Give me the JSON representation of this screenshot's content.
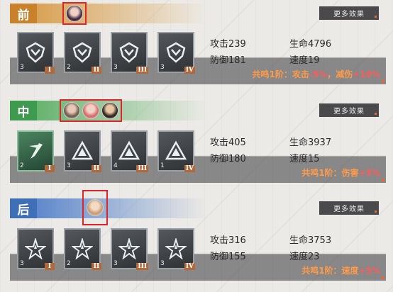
{
  "colors": {
    "front": "#c9822a",
    "middle": "#3e9a4e",
    "back": "#3f6fb6",
    "highlight_box": "#e0252a",
    "resonance_text": "#ff9a4a"
  },
  "rows": [
    {
      "badge": "前",
      "more_label": "更多效果",
      "cards": [
        {
          "level": "3",
          "tier": "I",
          "icon": "shield-emblem-icon"
        },
        {
          "level": "2",
          "tier": "II",
          "icon": "shield-emblem-icon"
        },
        {
          "level": "3",
          "tier": "III",
          "icon": "shield-emblem-icon"
        },
        {
          "level": "3",
          "tier": "IV",
          "icon": "shield-emblem-icon"
        }
      ],
      "stats": {
        "atk": "攻击239",
        "hp": "生命4796",
        "def": "防御181",
        "spd": "速度19"
      },
      "resonance": {
        "prefix": "共鸣1阶：攻击",
        "v1": "-5%",
        "mid": "，减伤",
        "v2": "+10%"
      }
    },
    {
      "badge": "中",
      "more_label": "更多效果",
      "cards": [
        {
          "level": "2",
          "tier": "I",
          "icon": "claw-emblem-icon"
        },
        {
          "level": "3",
          "tier": "II",
          "icon": "triangle-emblem-icon"
        },
        {
          "level": "4",
          "tier": "III",
          "icon": "triangle-emblem-icon"
        },
        {
          "level": "1",
          "tier": "IV",
          "icon": "triangle-emblem-icon"
        }
      ],
      "stats": {
        "atk": "攻击405",
        "hp": "生命3937",
        "def": "防御180",
        "spd": "速度15"
      },
      "resonance": {
        "prefix": "共鸣1阶：伤害",
        "v1": "+5%",
        "mid": "",
        "v2": ""
      }
    },
    {
      "badge": "后",
      "more_label": "更多效果",
      "cards": [
        {
          "level": "3",
          "tier": "I",
          "icon": "star-emblem-icon"
        },
        {
          "level": "2",
          "tier": "II",
          "icon": "star-emblem-icon"
        },
        {
          "level": "3",
          "tier": "III",
          "icon": "star-emblem-icon"
        },
        {
          "level": "3",
          "tier": "IV",
          "icon": "star-emblem-icon"
        }
      ],
      "stats": {
        "atk": "攻击316",
        "hp": "生命3753",
        "def": "防御155",
        "spd": "速度23"
      },
      "resonance": {
        "prefix": "共鸣1阶：速度",
        "v1": "+5%",
        "mid": "",
        "v2": ""
      }
    }
  ]
}
